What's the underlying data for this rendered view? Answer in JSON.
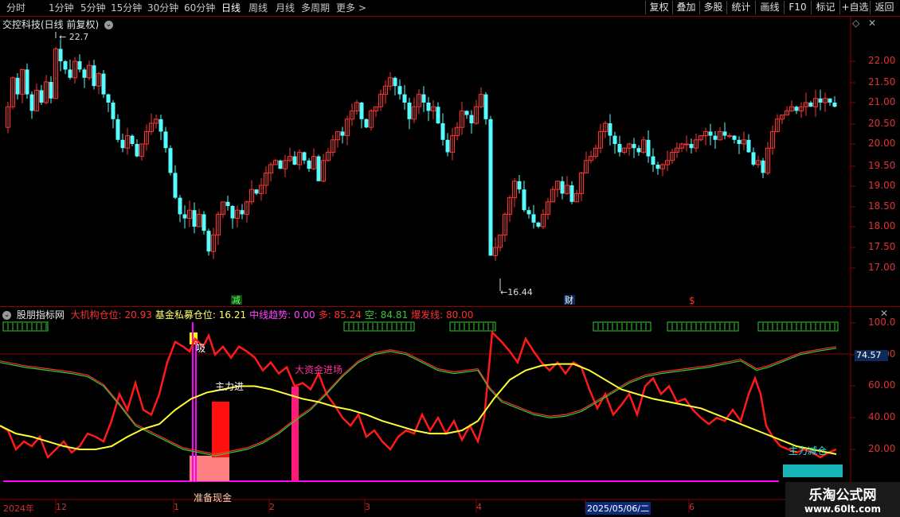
{
  "toolbar": {
    "periods": [
      "分时",
      "1分钟",
      "5分钟",
      "15分钟",
      "30分钟",
      "60分钟",
      "日线",
      "周线",
      "月线",
      "多周期",
      "更多 >"
    ],
    "active": "日线",
    "buttons": [
      "复权",
      "叠加",
      "多股",
      "统计",
      "画线",
      "F10",
      "标记",
      "+自选",
      "返回"
    ]
  },
  "title": "交控科技(日线 前复权)",
  "price_axis": [
    "22.00",
    "21.50",
    "21.00",
    "20.50",
    "20.00",
    "19.50",
    "19.00",
    "18.50",
    "18.00",
    "17.50",
    "17.00"
  ],
  "high_label": "22.7",
  "low_label": "16.44",
  "markers": {
    "jian": "减",
    "cai": "财",
    "s": "$"
  },
  "indicator": {
    "name": "股朋指标网",
    "items": [
      {
        "label": "大机构仓位:",
        "value": "20.93",
        "color": "#ff3030"
      },
      {
        "label": "基金私募仓位:",
        "value": "16.21",
        "color": "#ffff66"
      },
      {
        "label": "中线趋势:",
        "value": "0.00",
        "color": "#ff44ff"
      },
      {
        "label": "多:",
        "value": "85.24",
        "color": "#ff3030"
      },
      {
        "label": "空:",
        "value": "84.81",
        "color": "#33cc33"
      },
      {
        "label": "爆发线:",
        "value": "80.00",
        "color": "#ff3030"
      }
    ],
    "axis": [
      "100.0",
      "80.00",
      "60.00",
      "40.00",
      "20.00"
    ],
    "current_value": "74.57",
    "annotations": {
      "zhuli_jin": "主力进",
      "da_zijin": "大资金进场",
      "zhuli_jianc": "主力减仓",
      "zhunbei": "准备现金",
      "xi": "吸"
    }
  },
  "dates": [
    "2024年",
    "12",
    "1",
    "2",
    "3",
    "4",
    "2025/05/06/二",
    "5",
    "6"
  ],
  "watermark": {
    "line1": "乐淘公式网",
    "line2": "www.60lt.com"
  },
  "colors": {
    "up": "#ff3232",
    "down": "#54ffff",
    "grid": "#8b0000"
  }
}
